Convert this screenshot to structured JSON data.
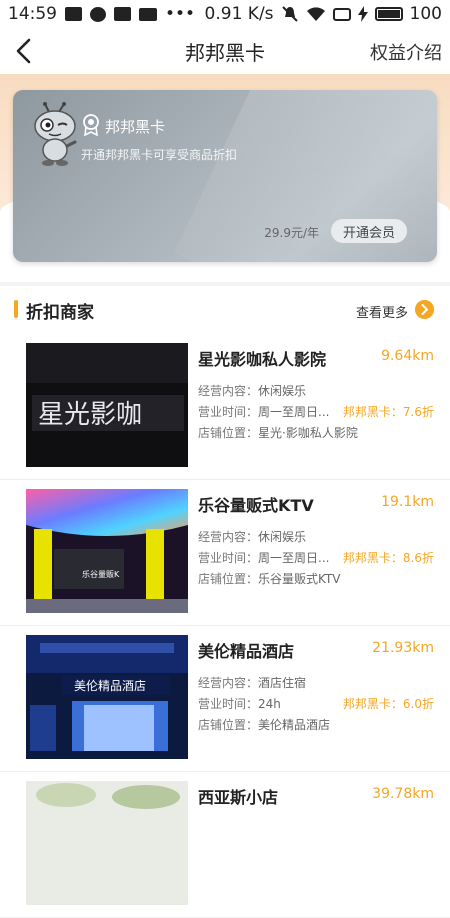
{
  "status_bar": {
    "time": "14:59",
    "speed": "0.91 K/s",
    "battery": "100"
  },
  "nav": {
    "title": "邦邦黑卡",
    "right_label": "权益介绍"
  },
  "card": {
    "title": "邦邦黑卡",
    "subtitle": "开通邦邦黑卡可享受商品折扣",
    "price": "29.9元/年",
    "open_button": "开通会员"
  },
  "section": {
    "title": "折扣商家",
    "more_label": "查看更多"
  },
  "merchants": [
    {
      "name": "星光影咖私人影院",
      "distance": "9.64km",
      "business_label": "经营内容：",
      "business": "休闲娱乐",
      "hours_label": "营业时间：",
      "hours": "周一至周日...",
      "location_label": "店铺位置：",
      "location": "星光·影咖私人影院",
      "discount": "邦邦黑卡：7.6折"
    },
    {
      "name": "乐谷量贩式KTV",
      "distance": "19.1km",
      "business_label": "经营内容：",
      "business": "休闲娱乐",
      "hours_label": "营业时间：",
      "hours": "周一至周日...",
      "location_label": "店铺位置：",
      "location": "乐谷量贩式KTV",
      "discount": "邦邦黑卡：8.6折"
    },
    {
      "name": "美伦精品酒店",
      "distance": "21.93km",
      "business_label": "经营内容：",
      "business": "酒店住宿",
      "hours_label": "营业时间：",
      "hours": "24h",
      "location_label": "店铺位置：",
      "location": "美伦精品酒店",
      "discount": "邦邦黑卡：6.0折"
    },
    {
      "name": "西亚斯小店",
      "distance": "39.78km"
    }
  ],
  "thumbs": {
    "cinema_sign": "星光影咖",
    "hotel_sign": "美伦精品酒店",
    "ktv_sign": "乐谷量贩K"
  },
  "colors": {
    "accent": "#f5a623",
    "card": "#a7b0b6",
    "hero": "#f8dcc0"
  }
}
